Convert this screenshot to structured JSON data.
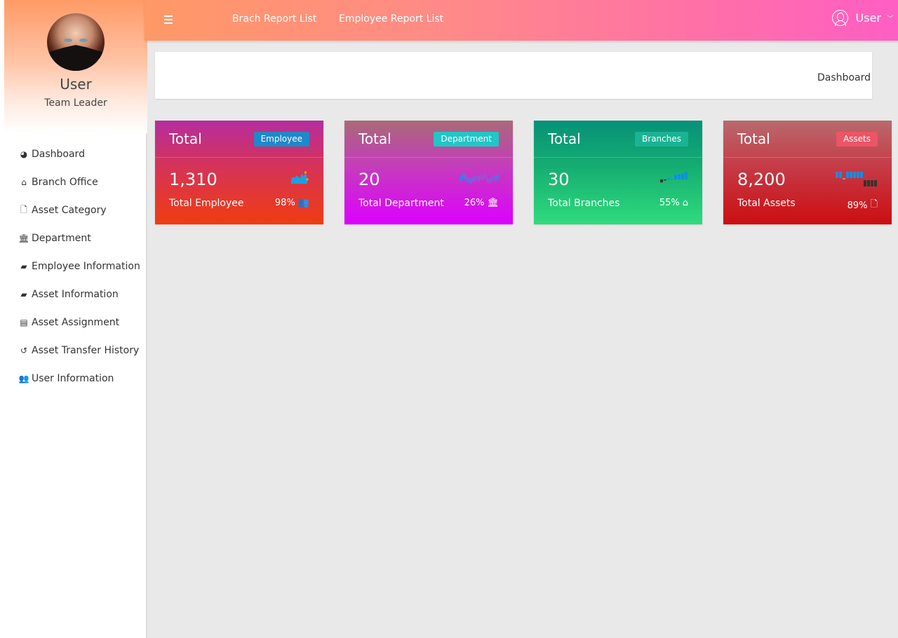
{
  "topbar": {
    "menu_icon": "hamburger-icon",
    "links": [
      "Brach Report List",
      "Employee Report List"
    ],
    "user_label": "User",
    "user_icon": "user-circle-icon",
    "caret_icon": "chevron-down-icon"
  },
  "sidebar": {
    "profile": {
      "name": "User",
      "role": "Team Leader"
    },
    "items": [
      {
        "label": "Dashboard",
        "icon": "dashboard-icon",
        "glyph": "◕"
      },
      {
        "label": "Branch Office",
        "icon": "home-icon",
        "glyph": "⌂"
      },
      {
        "label": "Asset Category",
        "icon": "file-zip-icon",
        "glyph": "🗋"
      },
      {
        "label": "Department",
        "icon": "bank-icon",
        "glyph": "🏛"
      },
      {
        "label": "Employee Information",
        "icon": "folder-open-icon",
        "glyph": "▰"
      },
      {
        "label": "Asset Information",
        "icon": "folder-open-icon",
        "glyph": "▰"
      },
      {
        "label": "Asset Assignment",
        "icon": "list-alt-icon",
        "glyph": "▤"
      },
      {
        "label": "Asset Transfer History",
        "icon": "history-icon",
        "glyph": "↺"
      },
      {
        "label": "User Information",
        "icon": "users-icon",
        "glyph": "👥"
      }
    ]
  },
  "breadcrumb": {
    "current": "Dashboard"
  },
  "cards": [
    {
      "title": "Total",
      "badge": "Employee",
      "badge_color": "#1f88c9",
      "value": "1,310",
      "label": "Total Employee",
      "percent": "98%",
      "icon": "users-icon",
      "glyph": "👥",
      "sparkline_type": "area",
      "sparkline": [
        3,
        5,
        4,
        6,
        5,
        4,
        7,
        5,
        8,
        3
      ],
      "spark_color": "#1ea0e0"
    },
    {
      "title": "Total",
      "badge": "Department",
      "badge_color": "#21c6c6",
      "value": "20",
      "label": "Total Department",
      "percent": "26%",
      "icon": "bank-icon",
      "glyph": "🏛",
      "sparkline_type": "candles",
      "sparkline": [
        5,
        7,
        7,
        4,
        3,
        2,
        4,
        5,
        6,
        5,
        7,
        6,
        8,
        4,
        3,
        5,
        6,
        5,
        7
      ],
      "spark_color": "#1e8ff0"
    },
    {
      "title": "Total",
      "badge": "Branches",
      "badge_color": "#1ab394",
      "value": "30",
      "label": "Total Branches",
      "percent": "55%",
      "icon": "home-icon",
      "glyph": "⌂",
      "sparkline_type": "bar",
      "sparkline": [
        -3,
        -1,
        1,
        0.3,
        3,
        3.5,
        4,
        5
      ],
      "spark_color": "#0e8fe8",
      "spark_neg_color": "#333333"
    },
    {
      "title": "Total",
      "badge": "Assets",
      "badge_color": "#ed5565",
      "value": "8,200",
      "label": "Total Assets",
      "percent": "89%",
      "icon": "file-zip-icon",
      "glyph": "🗋",
      "sparkline_type": "tristate",
      "sparkline": [
        1,
        1,
        0,
        1,
        1,
        1,
        1,
        1,
        -1,
        -1,
        -1,
        -1
      ],
      "spark_color": "#0e8fe8",
      "spark_neg_color": "#333333",
      "spark_zero_color": "#999999"
    }
  ]
}
